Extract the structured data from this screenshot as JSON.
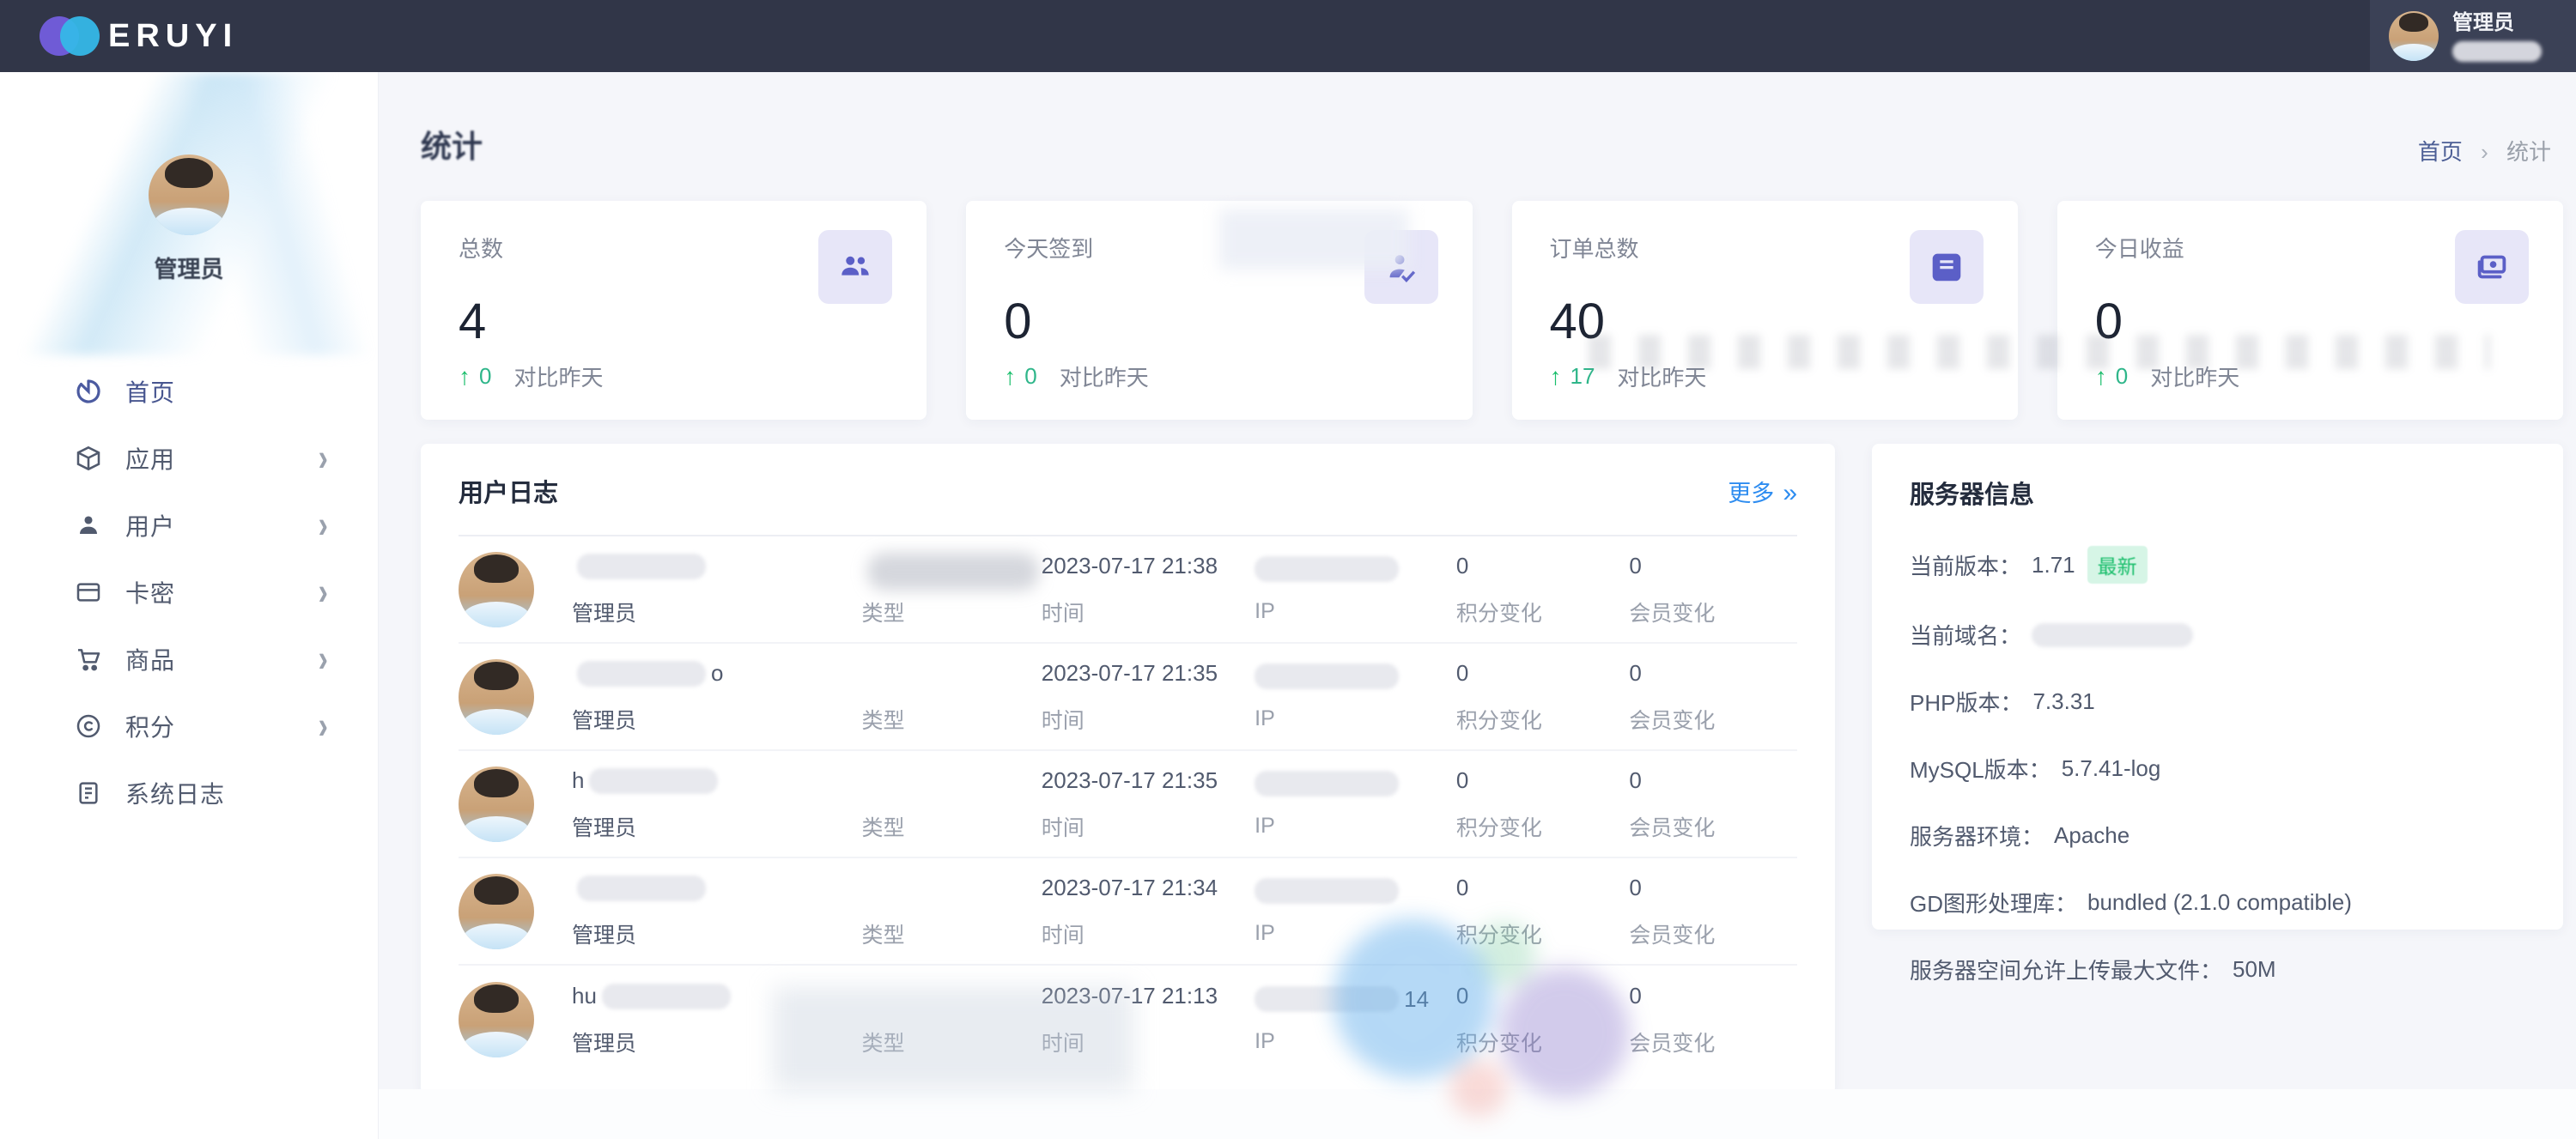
{
  "colors": {
    "topbar_bg": "#313648",
    "accent_blue": "#2d8cf0",
    "success_green": "#19be6b",
    "stat_icon_indigo": "#5b5fc7",
    "stat_icon_bg": "#e7e6f8",
    "content_bg": "#f5f6fa"
  },
  "topbar": {
    "logo_text": "ERUYI",
    "logo_icon": "two-circles-logo-icon",
    "admin_name": "管理员"
  },
  "sidebar": {
    "profile_name": "管理员",
    "chevron_glyph": "›",
    "items": [
      {
        "label": "首页",
        "icon": "dashboard-icon",
        "has_children": false,
        "active": true
      },
      {
        "label": "应用",
        "icon": "cube-icon",
        "has_children": true
      },
      {
        "label": "用户",
        "icon": "person-icon",
        "has_children": true
      },
      {
        "label": "卡密",
        "icon": "card-icon",
        "has_children": true
      },
      {
        "label": "商品",
        "icon": "cart-icon",
        "has_children": true
      },
      {
        "label": "积分",
        "icon": "coin-icon",
        "has_children": true
      },
      {
        "label": "系统日志",
        "icon": "log-file-icon",
        "has_children": false
      }
    ]
  },
  "page": {
    "title": "统计",
    "breadcrumb": {
      "home": "首页",
      "separator": "›",
      "current": "统计"
    }
  },
  "stat_cards": [
    {
      "title": "总数",
      "value": "4",
      "arrow": "↑",
      "delta": "0",
      "compare_label": "对比昨天",
      "icon": "users-icon"
    },
    {
      "title": "今天签到",
      "value": "0",
      "arrow": "↑",
      "delta": "0",
      "compare_label": "对比昨天",
      "icon": "person-check-icon"
    },
    {
      "title": "订单总数",
      "value": "40",
      "arrow": "↑",
      "delta": "17",
      "compare_label": "对比昨天",
      "icon": "calendar-icon"
    },
    {
      "title": "今日收益",
      "value": "0",
      "arrow": "↑",
      "delta": "0",
      "compare_label": "对比昨天",
      "icon": "banknote-icon"
    }
  ],
  "user_log": {
    "title": "用户日志",
    "more_label": "更多",
    "more_arrow": "»",
    "labels": {
      "type": "类型",
      "time": "时间",
      "ip": "IP",
      "points": "积分变化",
      "member": "会员变化"
    },
    "rows": [
      {
        "name_prefix": "",
        "name_suffix": "",
        "role": "管理员",
        "time": "2023-07-17 21:38",
        "ip_suffix": "",
        "points": "0",
        "member": "0"
      },
      {
        "name_prefix": "",
        "name_suffix": "o",
        "role": "管理员",
        "time": "2023-07-17 21:35",
        "ip_suffix": "",
        "points": "0",
        "member": "0"
      },
      {
        "name_prefix": "h",
        "name_suffix": "",
        "role": "管理员",
        "time": "2023-07-17 21:35",
        "ip_suffix": "",
        "points": "0",
        "member": "0"
      },
      {
        "name_prefix": "",
        "name_suffix": "",
        "role": "管理员",
        "time": "2023-07-17 21:34",
        "ip_suffix": "",
        "points": "0",
        "member": "0"
      },
      {
        "name_prefix": "hu",
        "name_suffix": "",
        "role": "管理员",
        "time": "2023-07-17 21:13",
        "ip_suffix": "14",
        "points": "0",
        "member": "0"
      }
    ]
  },
  "server_info": {
    "title": "服务器信息",
    "items": [
      {
        "label": "当前版本：",
        "value": "1.71",
        "badge": "最新"
      },
      {
        "label": "当前域名：",
        "value": "",
        "redacted": true
      },
      {
        "label": "PHP版本：",
        "value": "7.3.31"
      },
      {
        "label": "MySQL版本：",
        "value": "5.7.41-log"
      },
      {
        "label": "服务器环境：",
        "value": "Apache"
      },
      {
        "label": "GD图形处理库：",
        "value": "bundled (2.1.0 compatible)"
      },
      {
        "label": "服务器空间允许上传最大文件：",
        "value": "50M"
      }
    ]
  }
}
